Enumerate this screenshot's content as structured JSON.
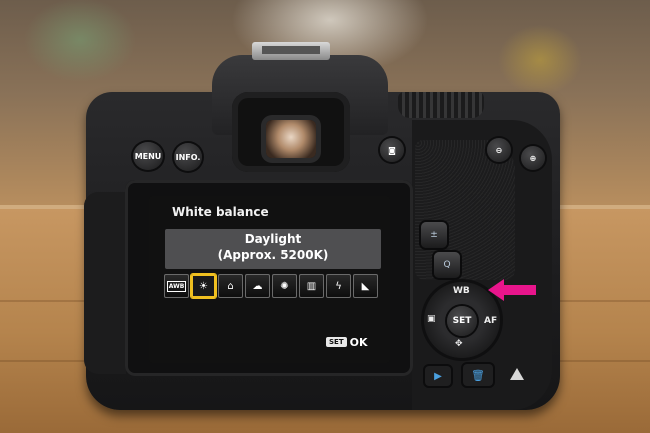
{
  "buttons": {
    "menu_label": "MENU",
    "info_label": "INFO."
  },
  "screen": {
    "title": "White balance",
    "mode": "Daylight",
    "temperature": "(Approx. 5200K)",
    "presets": [
      {
        "label": "AWB",
        "icon": "awb-icon"
      },
      {
        "label": "☀",
        "icon": "daylight-icon",
        "selected": true
      },
      {
        "label": "⌂",
        "icon": "shade-icon"
      },
      {
        "label": "☁",
        "icon": "cloudy-icon"
      },
      {
        "label": "✺",
        "icon": "tungsten-icon"
      },
      {
        "label": "▥",
        "icon": "fluorescent-icon"
      },
      {
        "label": "ϟ",
        "icon": "flash-icon"
      },
      {
        "label": "◣",
        "icon": "custom-wb-icon"
      }
    ],
    "set_label": "SET",
    "ok_label": "OK"
  },
  "controls": {
    "wb_label": "WB",
    "set_center_label": "SET",
    "af_label": "AF"
  },
  "colors": {
    "arrow": "#e8158c",
    "selection": "#f0c020",
    "panel": "#4f4f51"
  }
}
